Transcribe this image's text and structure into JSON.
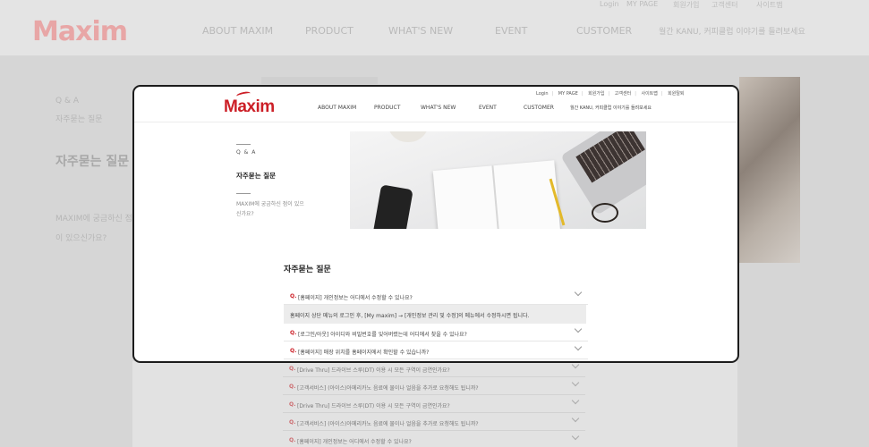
{
  "logo": "Maxim",
  "nav": [
    "ABOUT MAXIM",
    "PRODUCT",
    "WHAT'S NEW",
    "EVENT",
    "CUSTOMER"
  ],
  "nav_notice": "월간 KANU, 커피클럽 이야기를 들려보세요",
  "utility": [
    "Login",
    "MY PAGE",
    "회원가입",
    "고객센터",
    "사이트맵",
    "회원탈퇴"
  ],
  "sidebar": {
    "section": "Q & A",
    "active": "자주묻는 질문",
    "link": "MAXIM에 궁금하신 점이 있으신가요?"
  },
  "faq": {
    "title": "자주묻는 질문",
    "q_label": "Q.",
    "items": [
      "[홈페이지] 개인정보는 어디에서 수정할 수 있나요?",
      "[로그인/아웃] 아이디와 비밀번호를 잊어버렸는데 어디에서 찾을 수 있나요?",
      "[홈페이지] 매장 위치를 홈페이지에서 확인할 수 있습니까?",
      "[Drive Thru] 드라이브 스루(DT) 이용 시 모든 구역이 금연인가요?",
      "[고객서비스] (아이스)아메리카노 음료에 물이나 얼음을 추가로 요청해도 됩니까?",
      "[Drive Thru] 드라이브 스루(DT) 이용 시 모든 구역이 금연인가요?",
      "[고객서비스] (아이스)아메리카노 음료에 물이나 얼음을 추가로 요청해도 됩니까?",
      "[홈페이지] 개인정보는 어디에서 수정할 수 있나요?"
    ],
    "answer": "홈페이지 상단 메뉴의 로그인 후, [My maxim] → [개인정보 관리 및 수정]의 메뉴에서 수정하시면 됩니다."
  }
}
